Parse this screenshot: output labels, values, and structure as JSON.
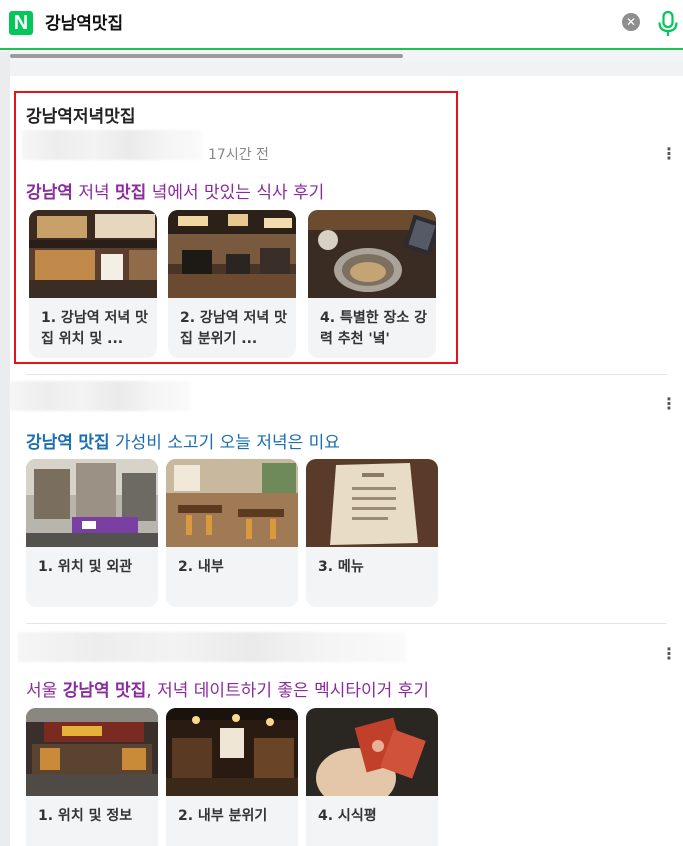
{
  "search": {
    "logo_letter": "N",
    "query": "강남역맛집"
  },
  "posts": [
    {
      "title": "강남역저녁맛집",
      "time": "17시간 전",
      "headline": [
        {
          "text": "강남역",
          "strong": true
        },
        {
          "text": " 저녁 ",
          "strong": false
        },
        {
          "text": "맛집",
          "strong": true
        },
        {
          "text": " 녘에서 맛있는 식사 후기",
          "strong": false
        }
      ],
      "cards": [
        {
          "label": "1. 강남역 저녁 맛집 위치 및 ..."
        },
        {
          "label": "2. 강남역 저녁 맛집 분위기 ..."
        },
        {
          "label": "4. 특별한 장소 강력 추천 '녘'"
        }
      ]
    },
    {
      "headline": [
        {
          "text": "강남역",
          "strong": true
        },
        {
          "text": " ",
          "strong": false
        },
        {
          "text": "맛집",
          "strong": true
        },
        {
          "text": " 가성비 소고기 오늘 저녁은 미요",
          "strong": false
        }
      ],
      "cards": [
        {
          "label": "1. 위치 및 외관"
        },
        {
          "label": "2. 내부"
        },
        {
          "label": "3. 메뉴"
        }
      ]
    },
    {
      "headline": [
        {
          "text": "서울 ",
          "strong": false
        },
        {
          "text": "강남역",
          "strong": true
        },
        {
          "text": " ",
          "strong": false
        },
        {
          "text": "맛집",
          "strong": true
        },
        {
          "text": ", 저녁 데이트하기 좋은 멕시타이거 후기",
          "strong": false
        }
      ],
      "cards": [
        {
          "label": "1. 위치 및 정보"
        },
        {
          "label": "2. 내부 분위기"
        },
        {
          "label": "4. 시식평"
        }
      ]
    }
  ],
  "colors": {
    "brand_green": "#03c75a",
    "highlight_red": "#e3131b",
    "link_purple": "#8b2c9c",
    "link_blue": "#1a6eb3"
  },
  "icons": {
    "clear": "clear-icon",
    "mic": "mic-icon",
    "more": "more-vertical-icon"
  }
}
